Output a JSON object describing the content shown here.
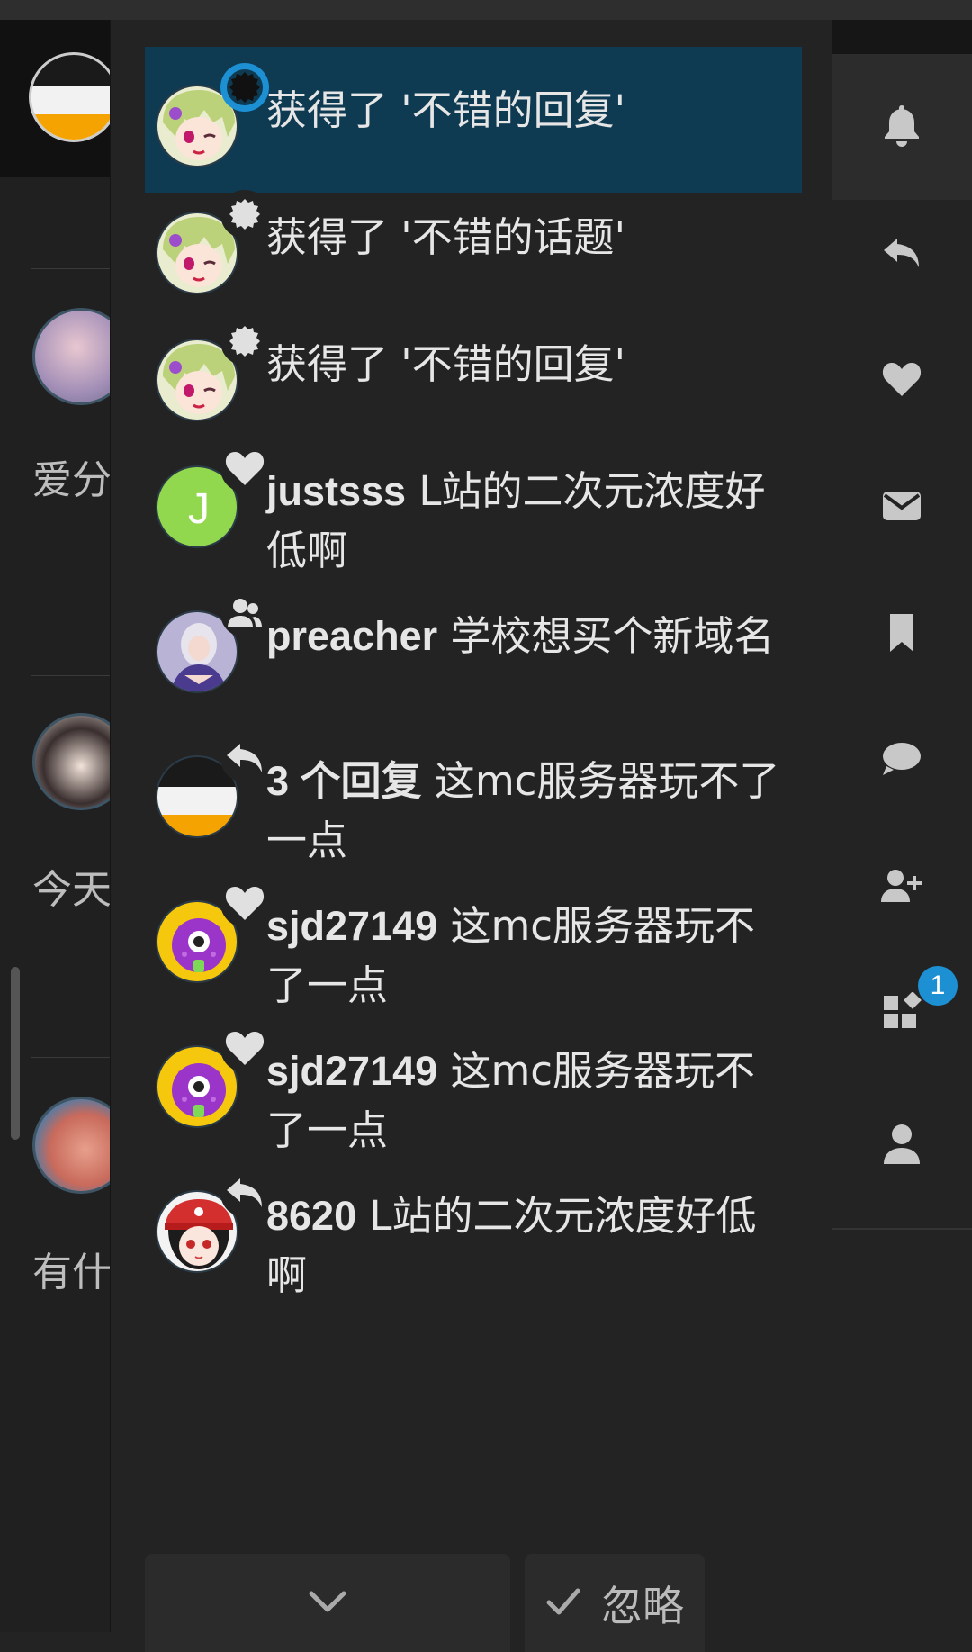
{
  "feed": {
    "snippets": [
      "爱分",
      "今天",
      "有什"
    ]
  },
  "notifications": [
    {
      "type": "badge",
      "user": "",
      "title": "获得了 '不错的回复'",
      "highlighted": true,
      "icon": "badge-certificate-icon",
      "avatar": "anime-girl-green-hair"
    },
    {
      "type": "badge",
      "user": "",
      "title": "获得了 '不错的话题'",
      "highlighted": false,
      "icon": "badge-certificate-icon",
      "avatar": "anime-girl-green-hair"
    },
    {
      "type": "badge",
      "user": "",
      "title": "获得了 '不错的回复'",
      "highlighted": false,
      "icon": "badge-certificate-icon",
      "avatar": "anime-girl-green-hair"
    },
    {
      "type": "liked",
      "user": "justsss",
      "title": "L站的二次元浓度好低啊",
      "highlighted": false,
      "icon": "heart-icon",
      "avatar": "letter-j"
    },
    {
      "type": "group",
      "user": "preacher",
      "title": "学校想买个新域名",
      "highlighted": false,
      "icon": "users-icon",
      "avatar": "cosplay-photo"
    },
    {
      "type": "replied",
      "user": "3 个回复",
      "title": "这mc服务器玩不了一点",
      "highlighted": false,
      "icon": "reply-icon",
      "avatar": "site-logo"
    },
    {
      "type": "liked",
      "user": "sjd27149",
      "title": "这mc服务器玩不了一点",
      "highlighted": false,
      "icon": "heart-icon",
      "avatar": "purple-monster"
    },
    {
      "type": "liked",
      "user": "sjd27149",
      "title": "这mc服务器玩不了一点",
      "highlighted": false,
      "icon": "heart-icon",
      "avatar": "purple-monster"
    },
    {
      "type": "replied",
      "user": "8620",
      "title": "L站的二次元浓度好低啊",
      "highlighted": false,
      "icon": "reply-icon",
      "avatar": "anime-girl-red-cap"
    }
  ],
  "footer": {
    "more_icon": "chevron-down-icon",
    "dismiss_label": "忽略",
    "dismiss_icon": "check-icon"
  },
  "rail": {
    "items": [
      {
        "icon": "bell-icon",
        "active": true
      },
      {
        "icon": "reply-icon",
        "active": false
      },
      {
        "icon": "heart-icon",
        "active": false
      },
      {
        "icon": "envelope-icon",
        "active": false
      },
      {
        "icon": "bookmark-icon",
        "active": false
      },
      {
        "icon": "comment-icon",
        "active": false
      },
      {
        "icon": "user-plus-icon",
        "active": false
      },
      {
        "icon": "widgets-icon",
        "active": false,
        "count": "1"
      },
      {
        "icon": "user-icon",
        "active": false
      }
    ]
  },
  "colors": {
    "highlight": "#0e3a52",
    "accent": "#1d8fd3",
    "background": "#232323"
  }
}
